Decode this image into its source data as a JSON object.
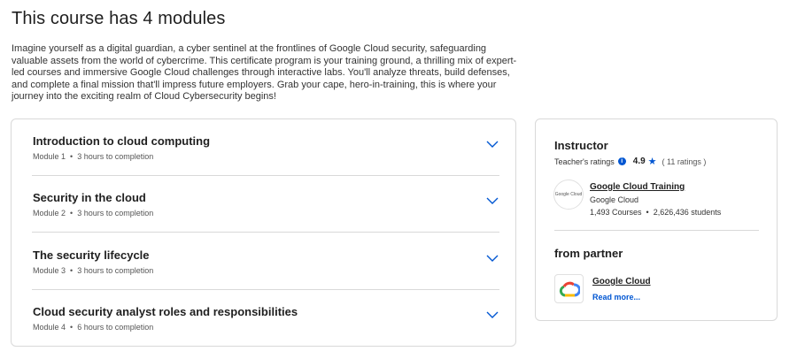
{
  "header": {
    "title": "This course has 4 modules",
    "description": "Imagine yourself as a digital guardian, a cyber sentinel at the frontlines of Google Cloud security, safeguarding valuable assets from the world of cybercrime. This certificate program is your training ground, a thrilling mix of expert-led courses and immersive Google Cloud challenges through interactive labs. You'll analyze threats, build defenses, and complete a final mission that'll impress future employers. Grab your cape, hero-in-training, this is where your journey into the exciting realm of Cloud Cybersecurity begins!"
  },
  "modules": [
    {
      "title": "Introduction to cloud computing",
      "module": "Module 1",
      "duration": "3 hours to completion"
    },
    {
      "title": "Security in the cloud",
      "module": "Module 2",
      "duration": "3 hours to completion"
    },
    {
      "title": "The security lifecycle",
      "module": "Module 3",
      "duration": "3 hours to completion"
    },
    {
      "title": "Cloud security analyst roles and responsibilities",
      "module": "Module 4",
      "duration": "6 hours to completion"
    }
  ],
  "instructor": {
    "heading": "Instructor",
    "ratings_label": "Teacher's ratings",
    "score": "4.9",
    "ratings_count": "( 11 ratings )",
    "logo_text": "Google Cloud",
    "name": "Google Cloud Training",
    "org": "Google Cloud",
    "courses": "1,493 Courses",
    "students": "2,626,436 students"
  },
  "partner": {
    "heading": "from partner",
    "name": "Google Cloud",
    "read_more": "Read more..."
  },
  "colors": {
    "accent": "#0056d2",
    "border": "#d9d9d9"
  }
}
